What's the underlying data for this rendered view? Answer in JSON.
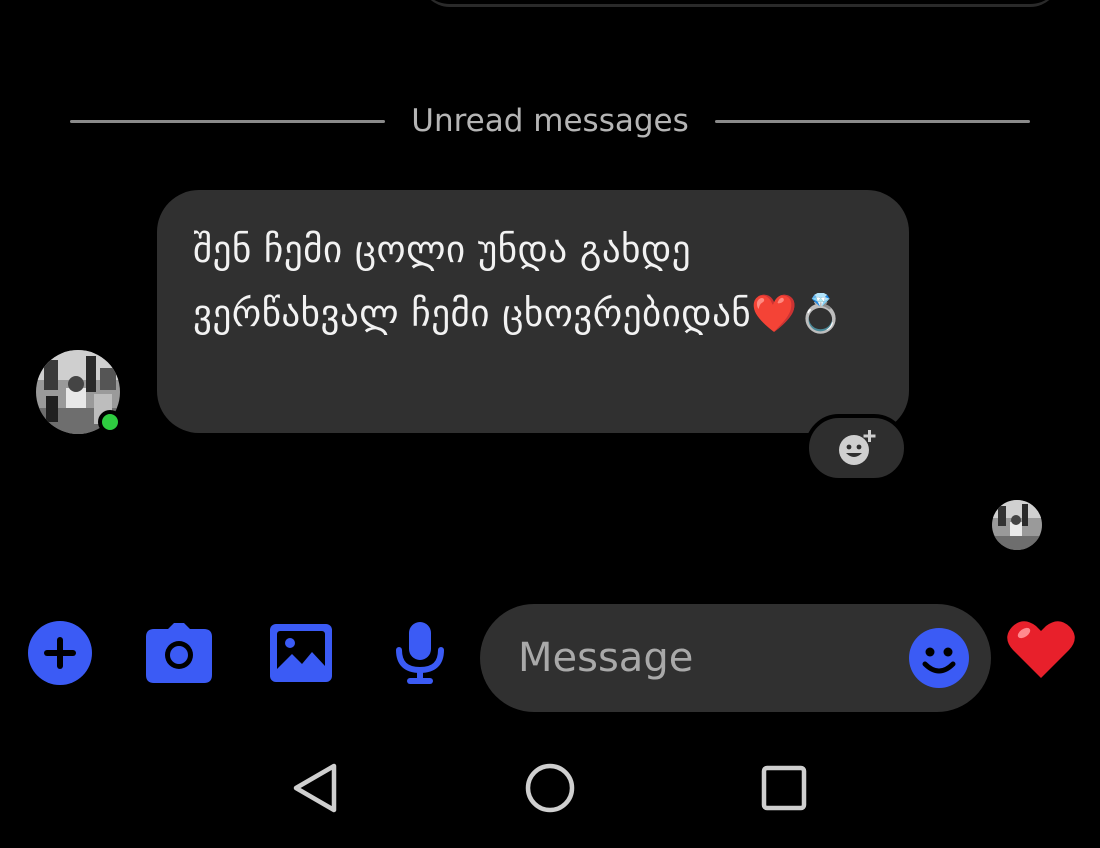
{
  "divider": {
    "label": "Unread messages"
  },
  "conversation": {
    "incoming": {
      "text": "შენ ჩემი ცოლი უნდა გახდე ვერწახვალ ჩემი ცხოვრებიდან❤️💍",
      "sender_online": true
    }
  },
  "composer": {
    "placeholder": "Message",
    "icons": [
      "plus-icon",
      "camera-icon",
      "gallery-icon",
      "microphone-icon",
      "emoji-icon",
      "heart-icon"
    ]
  },
  "colors": {
    "accent": "#3b5bf5",
    "bubble": "#303030",
    "online": "#2ecc40",
    "heart": "#e8202b"
  },
  "navigation": {
    "icons": [
      "back-icon",
      "home-icon",
      "recents-icon"
    ]
  }
}
